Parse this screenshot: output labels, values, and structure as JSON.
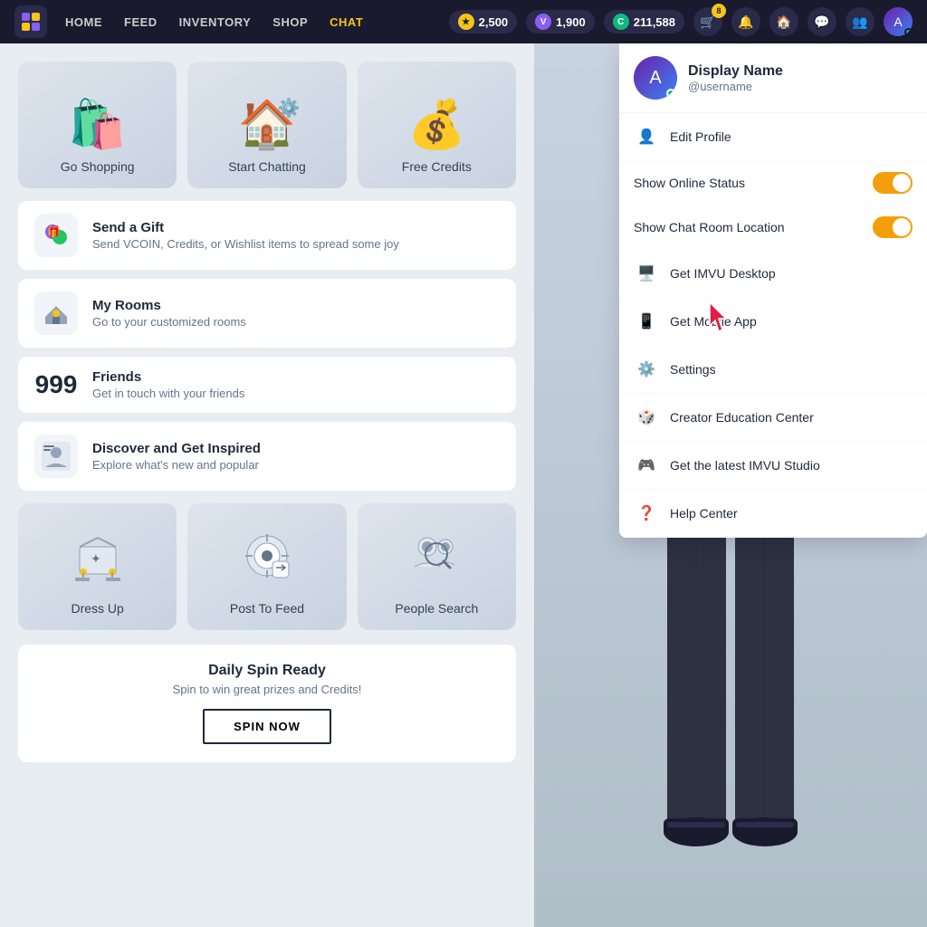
{
  "nav": {
    "logo": "🎮",
    "links": [
      {
        "label": "HOME",
        "active": false
      },
      {
        "label": "FEED",
        "active": false
      },
      {
        "label": "INVENTORY",
        "active": false
      },
      {
        "label": "SHOP",
        "active": false
      },
      {
        "label": "CHAT",
        "active": true
      }
    ],
    "currency1": {
      "amount": "2,500",
      "icon": "⭐"
    },
    "currency2": {
      "amount": "1,900",
      "icon": "V"
    },
    "currency3": {
      "amount": "211,588",
      "icon": "C"
    },
    "cart_badge": "8"
  },
  "top_cards": [
    {
      "label": "Go Shopping",
      "icon": "🛍️"
    },
    {
      "label": "Start Chatting",
      "icon": "🏠"
    },
    {
      "label": "Free Credits",
      "icon": "💰"
    }
  ],
  "list_items": [
    {
      "icon": "🎁",
      "title": "Send a Gift",
      "subtitle": "Send VCOIN, Credits, or Wishlist items to spread some joy"
    },
    {
      "icon": "🏠",
      "title": "My Rooms",
      "subtitle": "Go to your customized rooms"
    },
    {
      "icon": null,
      "title": "Friends",
      "subtitle": "Get in touch with your friends",
      "count": "999"
    },
    {
      "icon": "👤",
      "title": "Discover and Get Inspired",
      "subtitle": "Explore what's new and popular"
    }
  ],
  "bottom_cards": [
    {
      "label": "Dress Up",
      "icon": "👗"
    },
    {
      "label": "Post To Feed",
      "icon": "📷"
    },
    {
      "label": "People Search",
      "icon": "👥"
    }
  ],
  "daily_spin": {
    "title": "Daily Spin Ready",
    "subtitle": "Spin to win great prizes and Credits!",
    "button": "SPIN NOW"
  },
  "dropdown": {
    "display_name": "Display Name",
    "username": "@username",
    "items": [
      {
        "label": "Edit Profile",
        "icon": "👤"
      },
      {
        "label": "Show Online Status",
        "toggle": true,
        "on": true
      },
      {
        "label": "Show Chat Room Location",
        "toggle": true,
        "on": true
      },
      {
        "label": "Get IMVU Desktop",
        "icon": "💻"
      },
      {
        "label": "Get Mobile App",
        "icon": "📱"
      },
      {
        "label": "Settings",
        "icon": "⚙️"
      },
      {
        "label": "Creator Education Center",
        "icon": "🎲"
      },
      {
        "label": "Get the latest IMVU Studio",
        "icon": "🎮"
      },
      {
        "label": "Help Center",
        "icon": "❓"
      }
    ]
  }
}
